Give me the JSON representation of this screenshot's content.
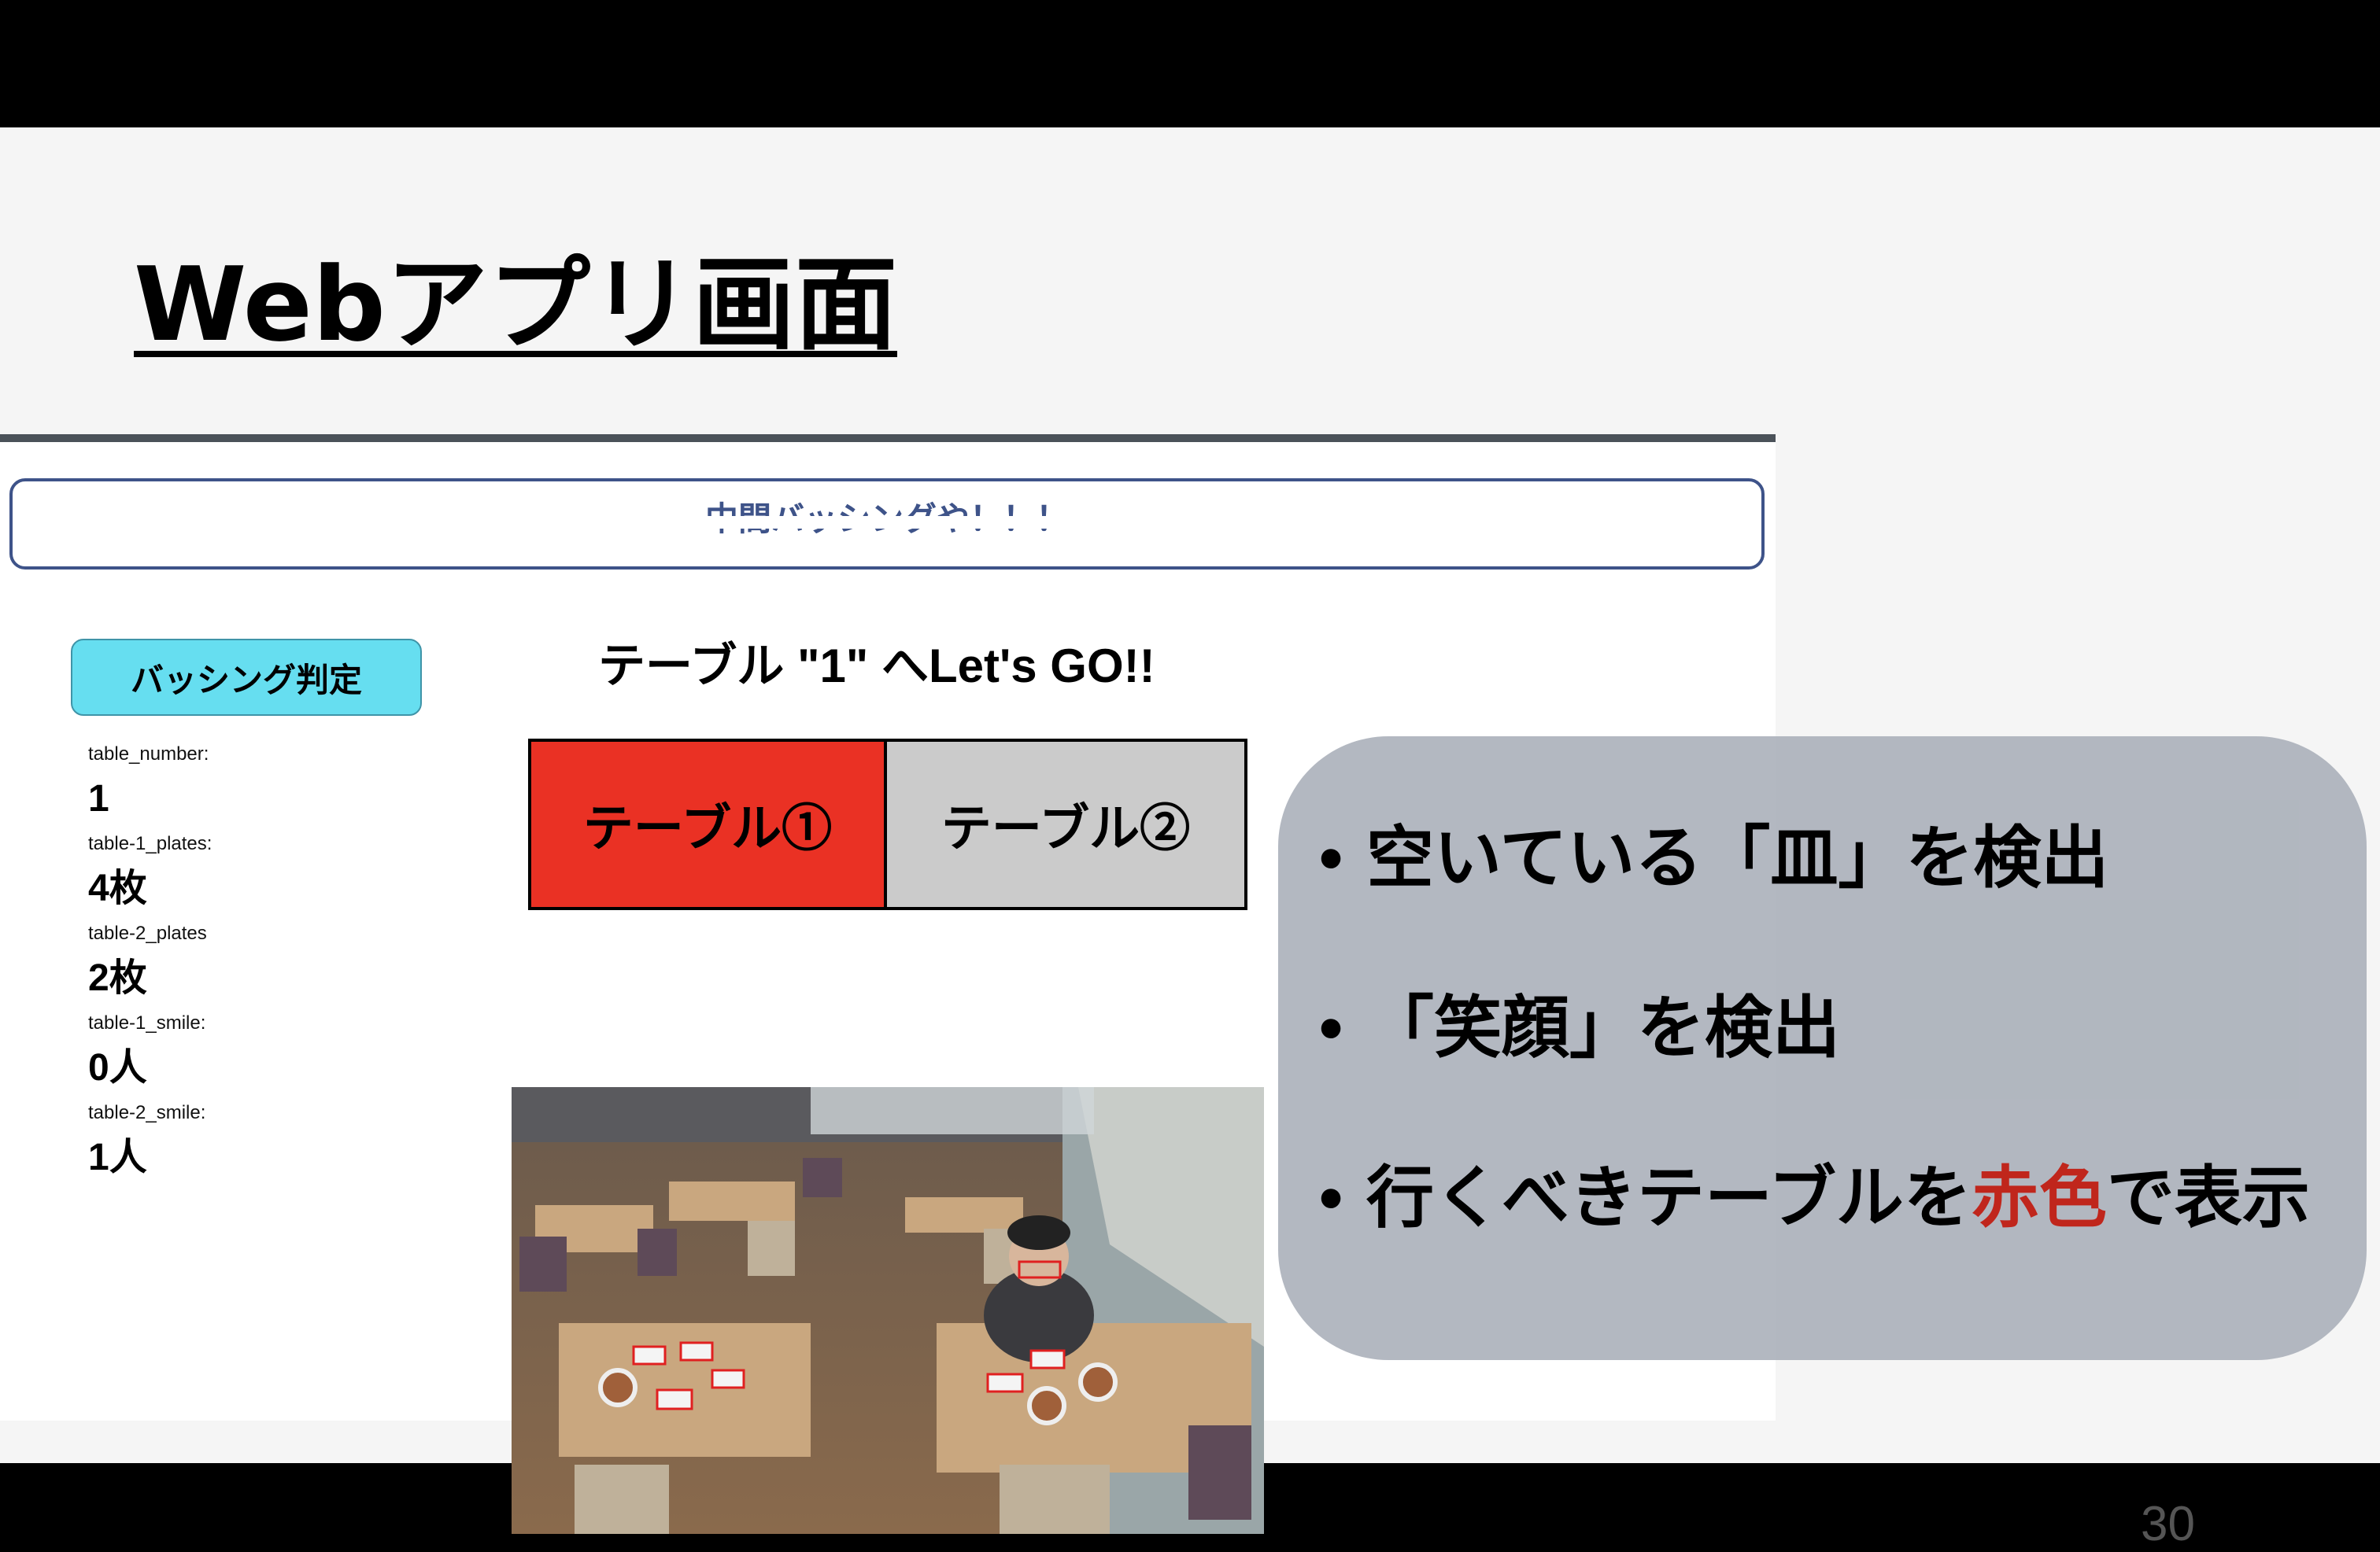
{
  "slide": {
    "title": "Webアプリ画面",
    "page_number": "30"
  },
  "app": {
    "banner": "中間バッシングや！！！",
    "judge_button": "バッシング判定",
    "go_message": "テーブル \"1\" へLet's GO!!",
    "stats": [
      {
        "label": "table_number:",
        "value": "1"
      },
      {
        "label": "table-1_plates:",
        "value": "4枚"
      },
      {
        "label": "table-2_plates",
        "value": "2枚"
      },
      {
        "label": "table-1_smile:",
        "value": "0人"
      },
      {
        "label": "table-2_smile:",
        "value": "1人"
      }
    ],
    "tables": [
      {
        "label": "テーブル①",
        "color": "#ea3124",
        "active": true
      },
      {
        "label": "テーブル②",
        "color": "#cbcbcb",
        "active": false
      }
    ]
  },
  "overlay": {
    "bullet_char": "•",
    "bullets": [
      "空いている「皿」を検出",
      "「笑顔」を検出"
    ],
    "bullet3_before": "行くべきテーブルを",
    "bullet3_highlight": "赤色",
    "bullet3_after": "で表示",
    "highlight_color": "#c0261c"
  },
  "colors": {
    "banner_border": "#3e5389",
    "judge_button_bg": "#66def0",
    "divider": "#4b5259"
  }
}
